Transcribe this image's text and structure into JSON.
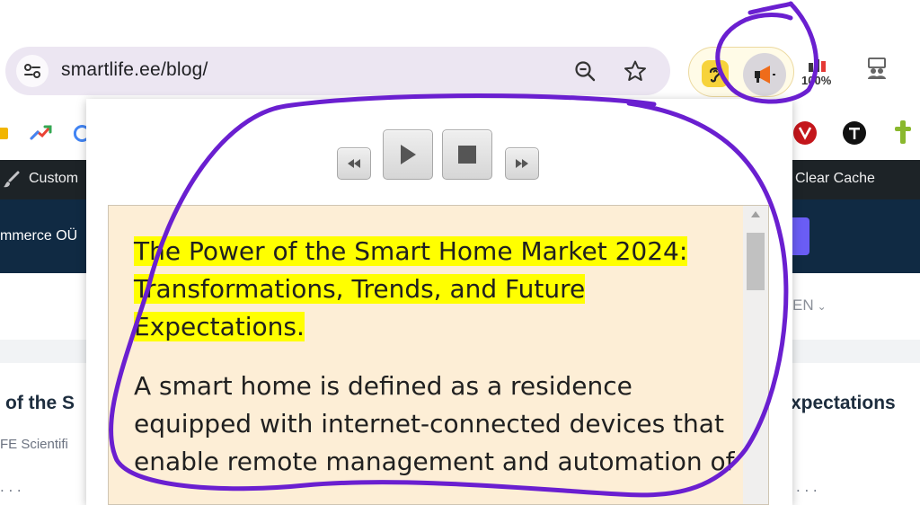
{
  "browser": {
    "url": "smartlife.ee/blog/",
    "zoom_badge": "100%"
  },
  "adminbar": {
    "customize_label": "Custom",
    "clear_cache_label": "Clear Cache"
  },
  "site": {
    "brand_fragment": "mmerce OÜ",
    "language": "EN"
  },
  "article": {
    "title_left_fragment": "of the S",
    "title_right_fragment": "xpectations",
    "meta_fragment": "FE Scientifi"
  },
  "reader": {
    "title": "The Power of the Smart Home Market 2024: Transformations, Trends, and Future Expectations.",
    "body": "A smart home is defined as a residence equipped with internet-connected devices that enable remote management and automation of"
  },
  "colors": {
    "highlight": "#ffff00",
    "reader_bg": "#fdeed6",
    "annotation": "#6a1fd0",
    "adminbar": "#1d2327",
    "site_header": "#102a43"
  }
}
